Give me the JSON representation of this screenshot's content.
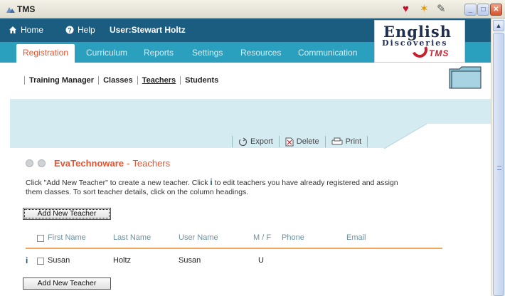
{
  "window": {
    "title": "TMS",
    "tray_icons": [
      "heart-icon",
      "stamp-icon",
      "note-icon"
    ]
  },
  "topbar": {
    "home_label": "Home",
    "help_label": "Help",
    "user_label": "User:Stewart Holtz"
  },
  "logo": {
    "line1": "English",
    "line2": "Discoveries",
    "line3": "TMS"
  },
  "tabs": [
    {
      "label": "Registration",
      "active": true
    },
    {
      "label": "Curriculum",
      "active": false
    },
    {
      "label": "Reports",
      "active": false
    },
    {
      "label": "Settings",
      "active": false
    },
    {
      "label": "Resources",
      "active": false
    },
    {
      "label": "Communication",
      "active": false
    }
  ],
  "subnav": [
    {
      "label": "Training Manager",
      "current": false
    },
    {
      "label": "Classes",
      "current": false
    },
    {
      "label": "Teachers",
      "current": true
    },
    {
      "label": "Students",
      "current": false
    }
  ],
  "toolbar": {
    "export_label": "Export",
    "delete_label": "Delete",
    "print_label": "Print"
  },
  "heading": {
    "org": "EvaTechnoware",
    "separator": "-",
    "section": "Teachers"
  },
  "instructions": {
    "part1": "Click \"Add New Teacher\" to create a new teacher. Click",
    "icon_glyph": "i",
    "part2": "to edit teachers you have already registered and assign them classes. To sort teacher details, click on the column headings."
  },
  "buttons": {
    "add_top": "Add New Teacher",
    "add_bottom": "Add New Teacher"
  },
  "table": {
    "columns": [
      "First Name",
      "Last Name",
      "User Name",
      "M / F",
      "Phone",
      "Email"
    ],
    "rows": [
      {
        "info": "i",
        "first": "Susan",
        "last": "Holtz",
        "user": "Susan",
        "gender": "U",
        "phone": "",
        "email": ""
      }
    ]
  },
  "colors": {
    "nav_dark": "#1a5d80",
    "tab_teal": "#2a9fbe",
    "accent_orange": "#e8542f",
    "band_blue": "#d5ebf2",
    "header_rule": "#f2a65a"
  }
}
